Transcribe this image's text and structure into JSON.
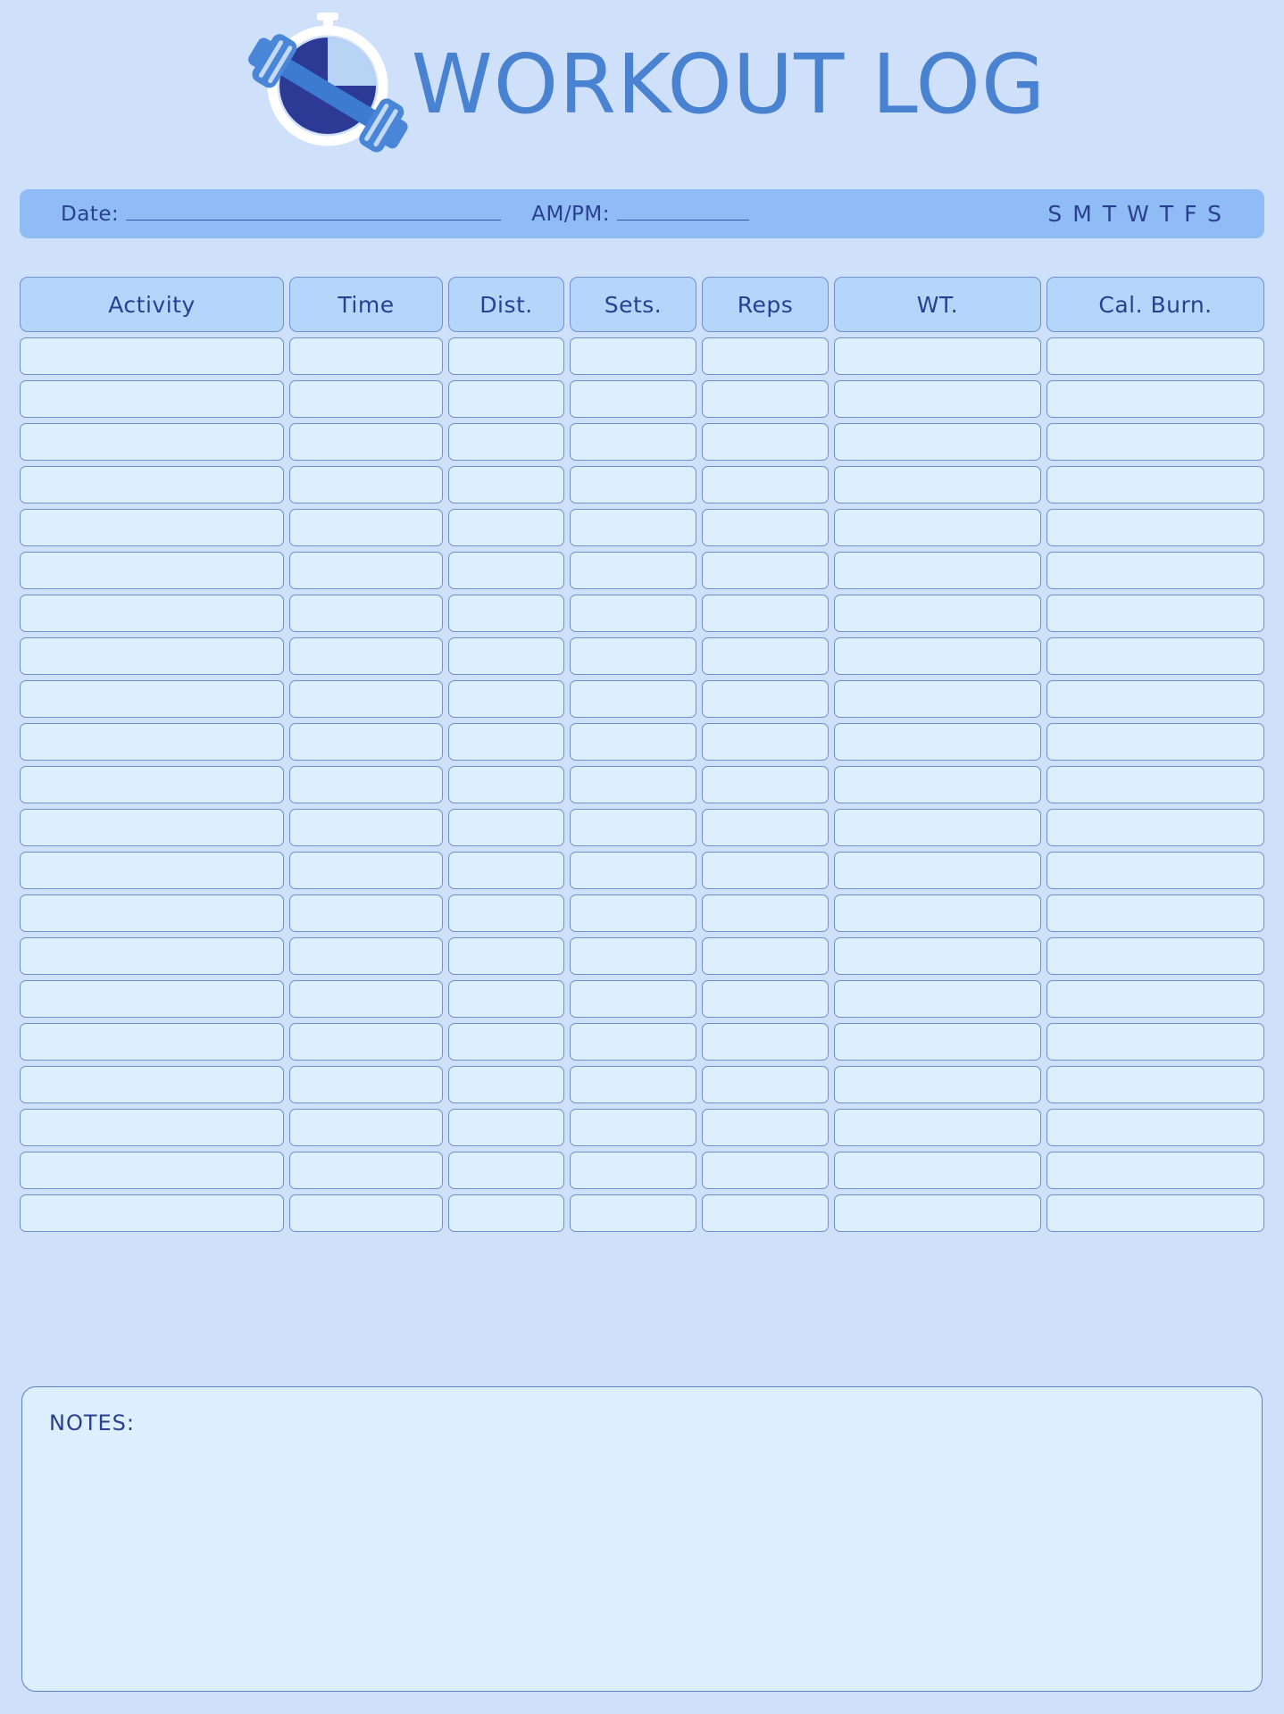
{
  "header": {
    "title": "WORKOUT LOG",
    "logo_icon": "stopwatch-dumbbell-icon"
  },
  "datebar": {
    "date_label": "Date:",
    "date_value": "",
    "ampm_label": "AM/PM:",
    "ampm_value": "",
    "days": [
      "S",
      "M",
      "T",
      "W",
      "T",
      "F",
      "S"
    ]
  },
  "table": {
    "columns": [
      "Activity",
      "Time",
      "Dist.",
      "Sets.",
      "Reps",
      "WT.",
      "Cal. Burn."
    ],
    "row_count": 21,
    "rows": [
      [
        "",
        "",
        "",
        "",
        "",
        "",
        ""
      ],
      [
        "",
        "",
        "",
        "",
        "",
        "",
        ""
      ],
      [
        "",
        "",
        "",
        "",
        "",
        "",
        ""
      ],
      [
        "",
        "",
        "",
        "",
        "",
        "",
        ""
      ],
      [
        "",
        "",
        "",
        "",
        "",
        "",
        ""
      ],
      [
        "",
        "",
        "",
        "",
        "",
        "",
        ""
      ],
      [
        "",
        "",
        "",
        "",
        "",
        "",
        ""
      ],
      [
        "",
        "",
        "",
        "",
        "",
        "",
        ""
      ],
      [
        "",
        "",
        "",
        "",
        "",
        "",
        ""
      ],
      [
        "",
        "",
        "",
        "",
        "",
        "",
        ""
      ],
      [
        "",
        "",
        "",
        "",
        "",
        "",
        ""
      ],
      [
        "",
        "",
        "",
        "",
        "",
        "",
        ""
      ],
      [
        "",
        "",
        "",
        "",
        "",
        "",
        ""
      ],
      [
        "",
        "",
        "",
        "",
        "",
        "",
        ""
      ],
      [
        "",
        "",
        "",
        "",
        "",
        "",
        ""
      ],
      [
        "",
        "",
        "",
        "",
        "",
        "",
        ""
      ],
      [
        "",
        "",
        "",
        "",
        "",
        "",
        ""
      ],
      [
        "",
        "",
        "",
        "",
        "",
        "",
        ""
      ],
      [
        "",
        "",
        "",
        "",
        "",
        "",
        ""
      ],
      [
        "",
        "",
        "",
        "",
        "",
        "",
        ""
      ],
      [
        "",
        "",
        "",
        "",
        "",
        "",
        ""
      ]
    ]
  },
  "notes": {
    "label": "NOTES:",
    "value": ""
  },
  "colors": {
    "page_background": "#cfe0fb",
    "title_blue": "#4a82d2",
    "ink_navy": "#2b3f90",
    "datebar_blue": "#8fbcf5",
    "header_cell_blue": "#b4d6fb",
    "body_cell_blue": "#ddeefc",
    "cell_border": "#6f8fd0"
  }
}
